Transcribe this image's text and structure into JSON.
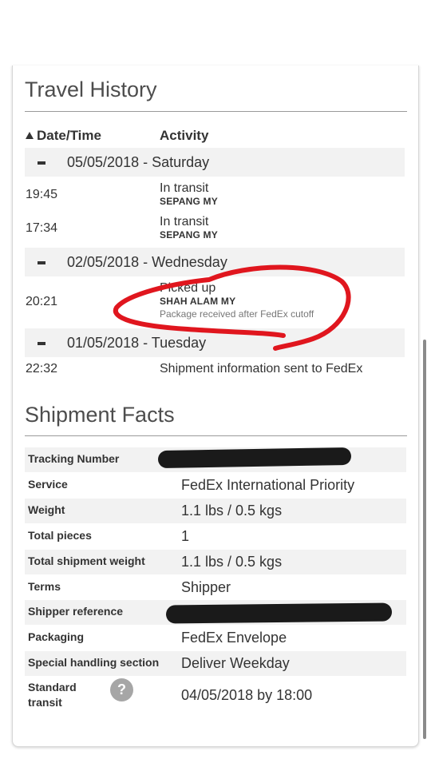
{
  "travel_history": {
    "title": "Travel History",
    "col_date": "Date/Time",
    "col_activity": "Activity",
    "days": [
      {
        "label": "05/05/2018 - Saturday",
        "events": [
          {
            "time": "19:45",
            "status": "In transit",
            "location": "SEPANG MY"
          },
          {
            "time": "17:34",
            "status": "In transit",
            "location": "SEPANG MY"
          }
        ]
      },
      {
        "label": "02/05/2018 - Wednesday",
        "events": [
          {
            "time": "20:21",
            "status": "Picked up",
            "location": "SHAH ALAM MY",
            "note": "Package received after FedEx cutoff"
          }
        ]
      },
      {
        "label": "01/05/2018 - Tuesday",
        "events": [
          {
            "time": "22:32",
            "status": "Shipment information sent to FedEx"
          }
        ]
      }
    ]
  },
  "shipment_facts": {
    "title": "Shipment Facts",
    "rows": [
      {
        "label": "Tracking Number",
        "value": ""
      },
      {
        "label": "Service",
        "value": "FedEx International Priority"
      },
      {
        "label": "Weight",
        "value": "1.1 lbs / 0.5 kgs"
      },
      {
        "label": "Total pieces",
        "value": "1"
      },
      {
        "label": "Total shipment weight",
        "value": "1.1 lbs / 0.5 kgs"
      },
      {
        "label": "Terms",
        "value": "Shipper"
      },
      {
        "label": "Shipper reference",
        "value": ""
      },
      {
        "label": "Packaging",
        "value": "FedEx Envelope"
      },
      {
        "label": "Special handling section",
        "value": "Deliver Weekday"
      }
    ],
    "standard_transit": {
      "label_line1": "Standard",
      "label_line2": "transit",
      "help_icon": "?",
      "value": "04/05/2018 by 18:00"
    }
  },
  "annotation": {
    "color": "#e0161e"
  },
  "colors": {
    "bar_bg": "#f2f2f2",
    "text": "#333333",
    "title": "#4d4d4d",
    "redaction": "#1a1a1a"
  }
}
